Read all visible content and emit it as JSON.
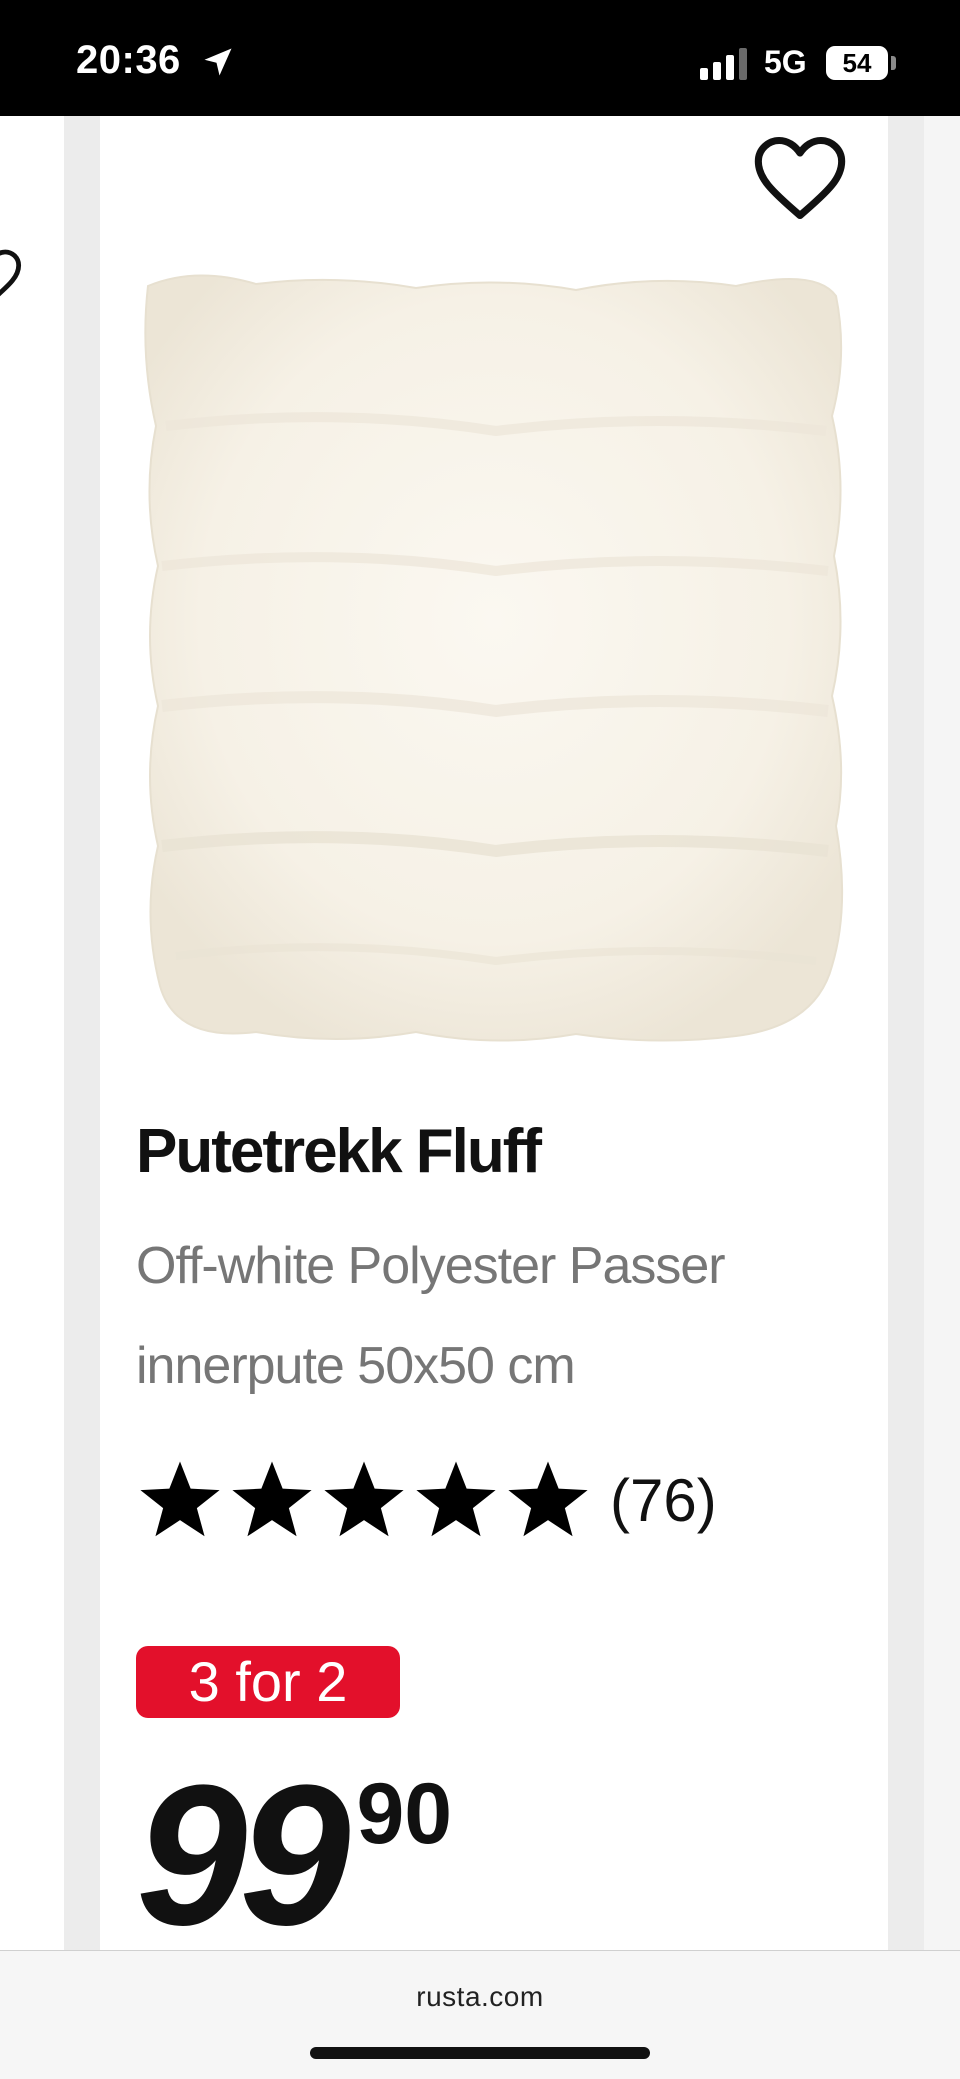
{
  "status_bar": {
    "time": "20:36",
    "network": "5G",
    "battery": "54"
  },
  "product": {
    "title": "Putetrekk Fluff",
    "subtitle": "Off-white Polyester Passer innerpute 50x50 cm",
    "rating_stars": 5,
    "review_count": "(76)",
    "badge": "3 for 2",
    "price_integer": "99",
    "price_decimal": "90"
  },
  "browser": {
    "url": "rusta.com"
  },
  "colors": {
    "badge": "#e3102b",
    "subtitle": "#767676"
  },
  "icons": {
    "favorite": "heart-outline-icon",
    "location": "location-arrow-icon",
    "star": "star-icon"
  }
}
